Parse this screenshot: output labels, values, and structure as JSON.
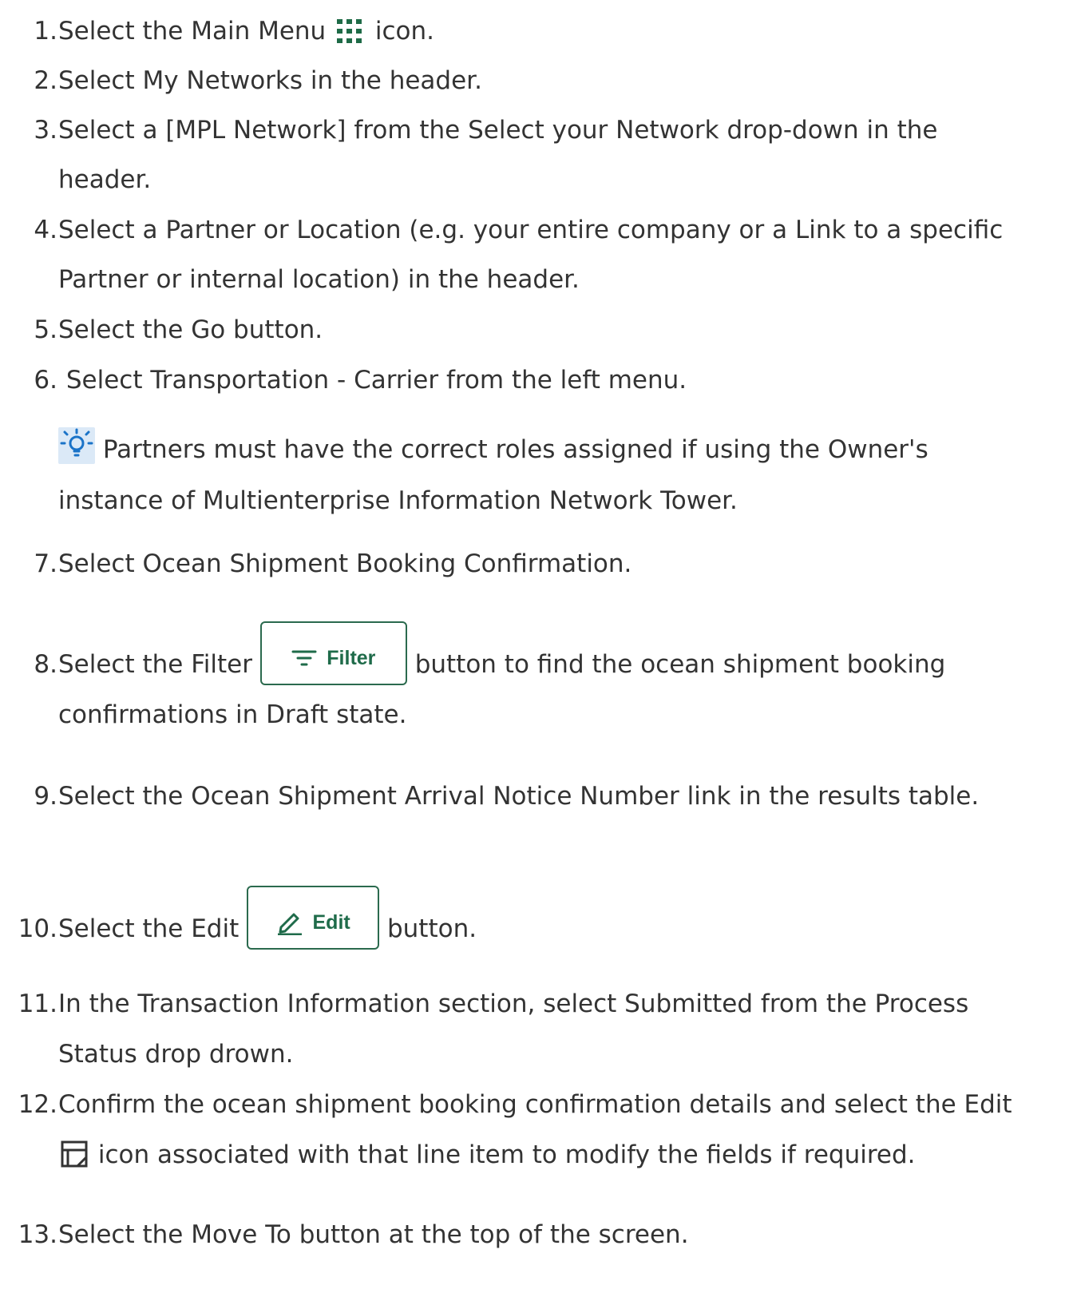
{
  "steps": [
    {
      "n": "1.",
      "lines": [
        [
          "Select the Main Menu ",
          "@menu-grid",
          " icon."
        ]
      ]
    },
    {
      "n": "2.",
      "lines": [
        [
          "Select My Networks in the header."
        ]
      ]
    },
    {
      "n": "3.",
      "lines": [
        [
          "Select a [MPL Network] from the Select your Network drop-down in the"
        ],
        [
          "header."
        ]
      ]
    },
    {
      "n": "4.",
      "lines": [
        [
          "Select a Partner or Location (e.g. your entire company or a Link to a specific"
        ],
        [
          "Partner or internal location) in the header."
        ]
      ]
    },
    {
      "n": "5.",
      "lines": [
        [
          "Select the Go button."
        ]
      ]
    },
    {
      "n": "6.",
      "lines": [
        [
          " Select Transportation - Carrier from the left menu."
        ]
      ]
    },
    {
      "n": "7.",
      "lines": [
        [
          "Select Ocean Shipment Booking Confirmation."
        ]
      ]
    },
    {
      "n": "8.",
      "lines": [
        [
          "Select the Filter ",
          "@filter-button",
          " button to find the ocean shipment booking"
        ],
        [
          "confirmations in Draft state."
        ]
      ]
    },
    {
      "n": "9.",
      "lines": [
        [
          "Select the Ocean Shipment Arrival Notice Number link in the results table."
        ]
      ]
    },
    {
      "n": "10.",
      "lines": [
        [
          "Select the Edit ",
          "@edit-button",
          " button."
        ]
      ]
    },
    {
      "n": "11.",
      "lines": [
        [
          "In the Transaction Information section, select Submitted from the Process"
        ],
        [
          "Status drop drown."
        ]
      ]
    },
    {
      "n": "12.",
      "lines": [
        [
          "Confirm the ocean shipment booking confirmation details and select the Edit"
        ],
        [
          "@edit-icon",
          " icon associated with that line item to modify the fields if required."
        ]
      ]
    },
    {
      "n": "13.",
      "lines": [
        [
          "Select the Move To button at the top of the screen."
        ]
      ]
    }
  ],
  "tip": {
    "icon": "lightbulb-icon",
    "lines": [
      " Partners must have the correct roles assigned if using the Owner's",
      "instance of Multienterprise Information Network Tower."
    ]
  },
  "buttons": {
    "filter": {
      "label": "Filter",
      "icon": "filter-lines-icon"
    },
    "edit": {
      "label": "Edit",
      "icon": "pencil-icon"
    }
  },
  "colors": {
    "text": "#333333",
    "accent_green": "#1f6b4a",
    "menu_dots": "#1e6b47",
    "tip_blue": "#1a73c8",
    "tip_bg": "#dbe9f7"
  }
}
